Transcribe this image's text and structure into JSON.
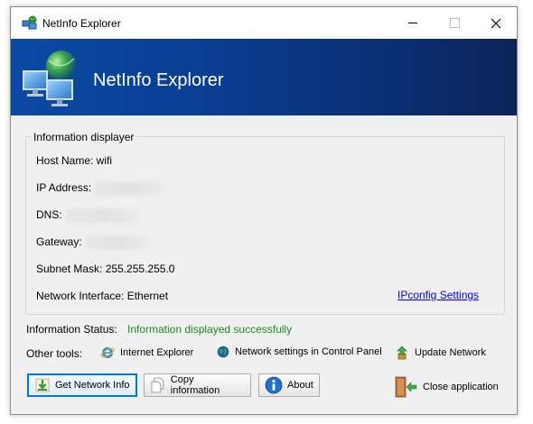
{
  "window": {
    "title": "NetInfo Explorer",
    "banner_title": "NetInfo Explorer"
  },
  "info": {
    "group_label": "Information displayer",
    "host_name": "Host Name: wifi",
    "ip_label": "IP Address:",
    "dns_label": "DNS:",
    "gateway_label": "Gateway:",
    "subnet": "Subnet Mask: 255.255.255.0",
    "interface": "Network Interface: Ethernet",
    "ipconfig_link": "IPconfig Settings"
  },
  "status": {
    "label": "Information Status:",
    "value": "Information displayed successfully",
    "color": "#1f8a1f"
  },
  "tools": {
    "label": "Other tools:",
    "items": [
      {
        "label": "Internet Explorer",
        "icon": "internet-explorer-icon"
      },
      {
        "label": "Network settings in Control Panel",
        "icon": "globe-icon"
      },
      {
        "label": "Update Network",
        "icon": "update-icon"
      }
    ]
  },
  "buttons": {
    "get_info": "Get Network Info",
    "copy": "Copy information",
    "about": "About",
    "close": "Close application"
  },
  "colors": {
    "banner": "#0a3d91",
    "link": "#0000ff",
    "focus": "#0078d7"
  }
}
